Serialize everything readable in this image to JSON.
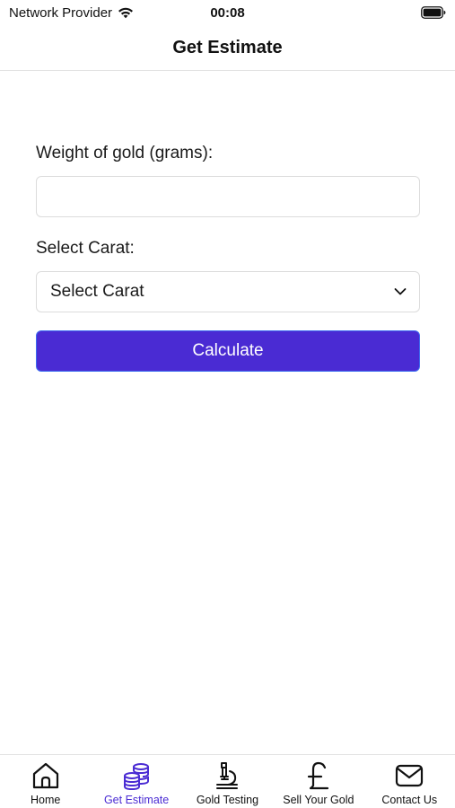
{
  "status_bar": {
    "carrier": "Network Provider",
    "time": "00:08"
  },
  "header": {
    "title": "Get Estimate"
  },
  "form": {
    "weight_label": "Weight of gold (grams):",
    "weight_value": "",
    "carat_label": "Select Carat:",
    "carat_selected": "Select Carat",
    "calculate_label": "Calculate"
  },
  "tabs": [
    {
      "label": "Home",
      "icon": "home-icon",
      "active": false
    },
    {
      "label": "Get Estimate",
      "icon": "coins-icon",
      "active": true
    },
    {
      "label": "Gold Testing",
      "icon": "microscope-icon",
      "active": false
    },
    {
      "label": "Sell Your Gold",
      "icon": "pound-icon",
      "active": false
    },
    {
      "label": "Contact Us",
      "icon": "mail-icon",
      "active": false
    }
  ],
  "colors": {
    "accent": "#4a2bd3",
    "button_border": "#3d6cf0",
    "inactive_icon": "#111111"
  }
}
